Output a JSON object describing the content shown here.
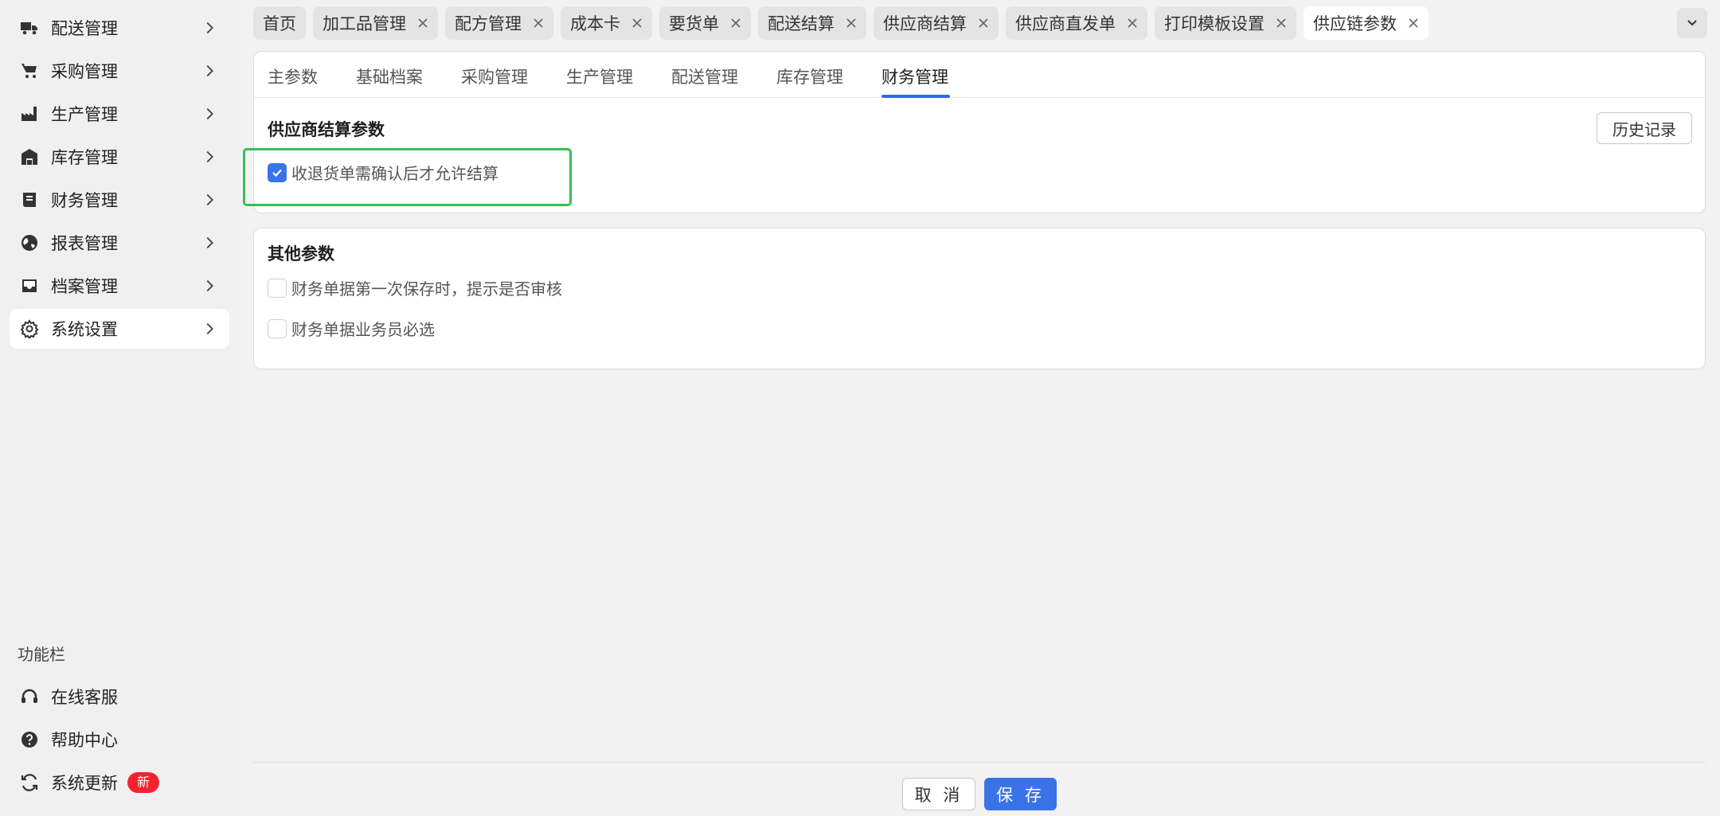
{
  "sidebar": {
    "items": [
      {
        "label": "配送管理",
        "icon": "truck-icon"
      },
      {
        "label": "采购管理",
        "icon": "cart-icon"
      },
      {
        "label": "生产管理",
        "icon": "factory-icon"
      },
      {
        "label": "库存管理",
        "icon": "warehouse-icon"
      },
      {
        "label": "财务管理",
        "icon": "ledger-icon"
      },
      {
        "label": "报表管理",
        "icon": "globe-icon"
      },
      {
        "label": "档案管理",
        "icon": "inbox-icon"
      },
      {
        "label": "系统设置",
        "icon": "gear-icon"
      }
    ],
    "section_title": "功能栏",
    "tools": [
      {
        "label": "在线客服",
        "icon": "headset-icon"
      },
      {
        "label": "帮助中心",
        "icon": "help-icon"
      },
      {
        "label": "系统更新",
        "icon": "refresh-icon",
        "badge": "新"
      }
    ]
  },
  "tabs": [
    {
      "label": "首页",
      "closable": false
    },
    {
      "label": "加工品管理",
      "closable": true
    },
    {
      "label": "配方管理",
      "closable": true
    },
    {
      "label": "成本卡",
      "closable": true
    },
    {
      "label": "要货单",
      "closable": true
    },
    {
      "label": "配送结算",
      "closable": true
    },
    {
      "label": "供应商结算",
      "closable": true
    },
    {
      "label": "供应商直发单",
      "closable": true
    },
    {
      "label": "打印模板设置",
      "closable": true
    },
    {
      "label": "供应链参数",
      "closable": true,
      "active": true
    }
  ],
  "sub_tabs": [
    "主参数",
    "基础档案",
    "采购管理",
    "生产管理",
    "配送管理",
    "库存管理",
    "财务管理"
  ],
  "active_sub_tab": "财务管理",
  "supplier_section": {
    "title": "供应商结算参数",
    "history_button": "历史记录",
    "option": {
      "label": "收退货单需确认后才允许结算",
      "checked": true
    }
  },
  "other_section": {
    "title": "其他参数",
    "options": [
      {
        "label": "财务单据第一次保存时，提示是否审核",
        "checked": false
      },
      {
        "label": "财务单据业务员必选",
        "checked": false
      }
    ]
  },
  "footer": {
    "cancel": "取 消",
    "save": "保 存"
  },
  "colors": {
    "accent": "#3a73e8",
    "highlight": "#36c05a",
    "badge": "#f5222d"
  }
}
